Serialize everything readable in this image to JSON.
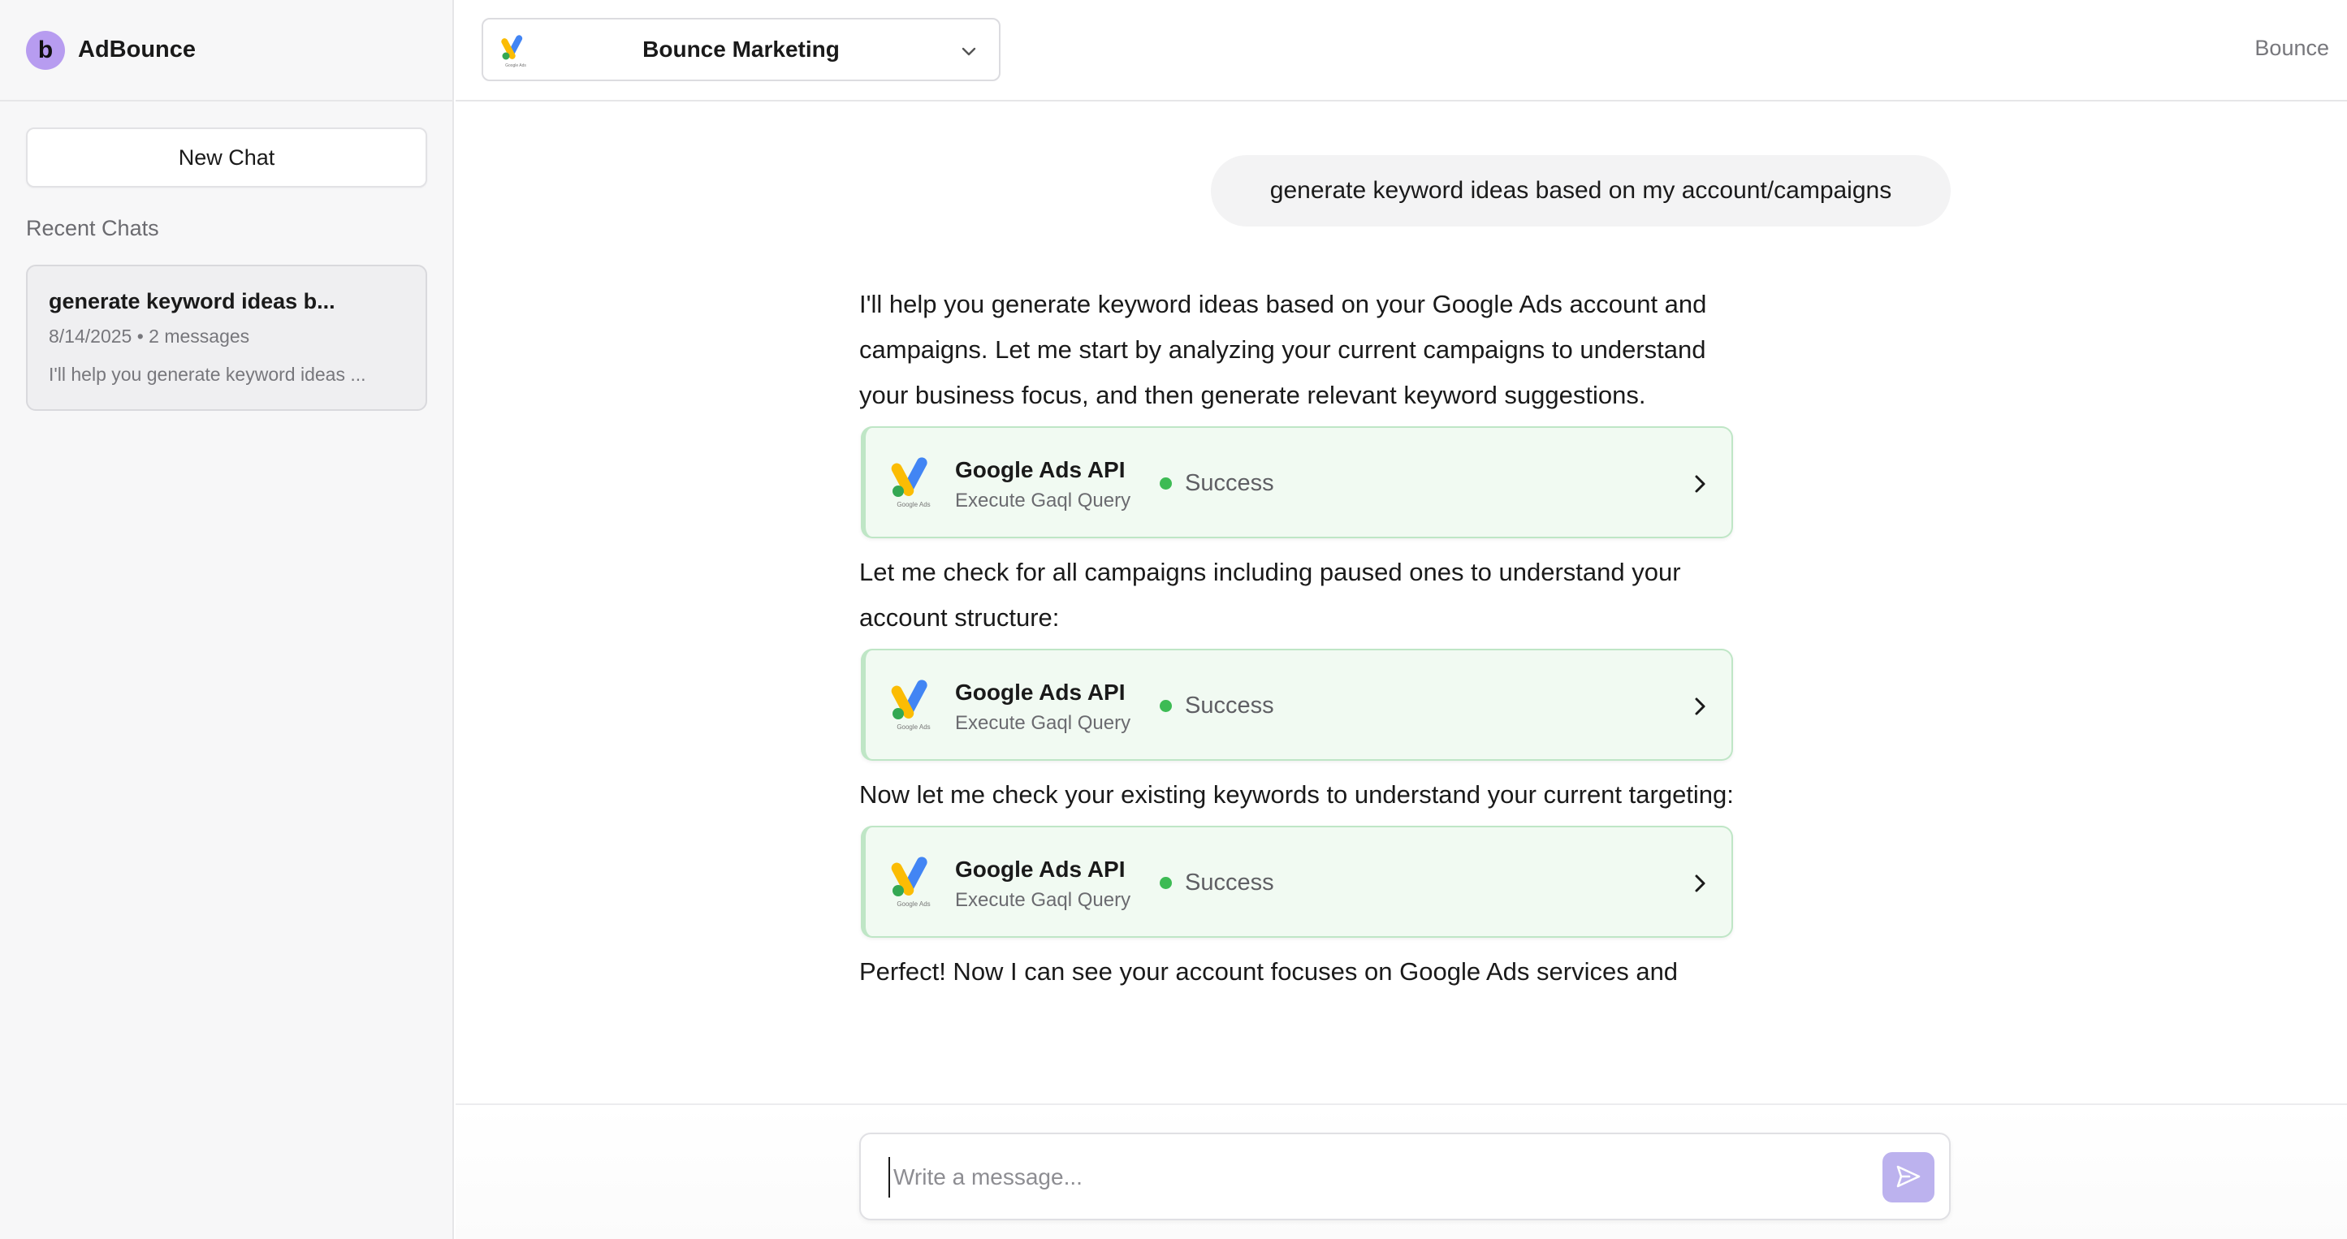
{
  "sidebar": {
    "brand_logo_letter": "b",
    "brand_name": "AdBounce",
    "new_chat_label": "New Chat",
    "recent_title": "Recent Chats",
    "chats": [
      {
        "title": "generate keyword ideas b...",
        "meta": "8/14/2025 • 2 messages",
        "preview": "I'll help you generate keyword ideas ..."
      }
    ]
  },
  "topbar": {
    "account_name": "Bounce Marketing",
    "user_name": "Bounce"
  },
  "conversation": {
    "user_message": "generate keyword ideas based on my account/campaigns",
    "assistant_blocks": [
      "I'll help you generate keyword ideas based on your Google Ads account and campaigns. Let me start by analyzing your current campaigns to understand your business focus, and then generate relevant keyword suggestions.",
      "Let me check for all campaigns including paused ones to understand your account structure:",
      "Now let me check your existing keywords to understand your current targeting:",
      "Perfect! Now I can see your account focuses on Google Ads services and"
    ],
    "tool_calls": [
      {
        "title": "Google Ads API",
        "subtitle": "Execute Gaql Query",
        "status": "Success"
      },
      {
        "title": "Google Ads API",
        "subtitle": "Execute Gaql Query",
        "status": "Success"
      },
      {
        "title": "Google Ads API",
        "subtitle": "Execute Gaql Query",
        "status": "Success"
      }
    ],
    "logo_caption": "Google Ads"
  },
  "composer": {
    "placeholder": "Write a message..."
  },
  "colors": {
    "brand_purple": "#b79cf0",
    "success_green": "#3dbb54",
    "tool_card_bg": "#f1faf2",
    "tool_card_border": "#bfe6c6",
    "send_button": "#bcb2ee"
  },
  "icons": [
    "google-ads-icon",
    "chevron-down-icon",
    "chevron-right-icon",
    "send-icon"
  ]
}
